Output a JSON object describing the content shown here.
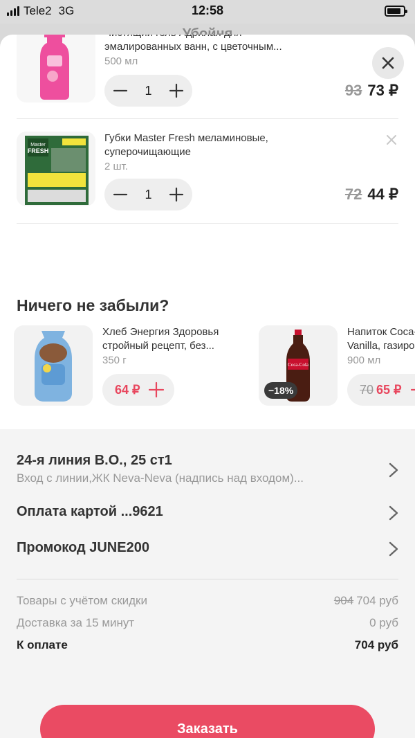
{
  "status_bar": {
    "carrier": "Tele2",
    "network": "3G",
    "time": "12:58",
    "battery_level": 0.85
  },
  "background_title": "Убойня",
  "cart": {
    "items": [
      {
        "name": "Чистящий гель Адрилан для эмалированных ванн, с цветочным...",
        "name_line1": "Чистящий гель Адрилан для",
        "name_line2": "эмалированных ванн, с цветочным...",
        "weight": "500 мл",
        "quantity": "1",
        "old_price": "93",
        "price": "73 ₽"
      },
      {
        "name_line1": "Губки Master Fresh меламиновые,",
        "name_line2": "суперочищающие",
        "weight": "2 шт.",
        "quantity": "1",
        "old_price": "72",
        "price": "44 ₽"
      }
    ]
  },
  "recommendations": {
    "title": "Ничего не забыли?",
    "items": [
      {
        "name_line1": "Хлеб Энергия Здоровья",
        "name_line2": "стройный рецепт, без...",
        "weight": "350 г",
        "price": "64 ₽"
      },
      {
        "name_line1": "Напиток Coca-Cola",
        "name_line2": "Vanilla, газированный",
        "weight": "900 мл",
        "old_price": "70",
        "price": "65 ₽",
        "discount": "−18%"
      }
    ]
  },
  "checkout": {
    "address_main": "24-я линия В.О., 25 ст1",
    "address_sub": "Вход с линии,ЖК Neva-Neva (надпись над входом)...",
    "payment": "Оплата картой ...9621",
    "promo": "Промокод JUNE200",
    "summary": {
      "goods_label": "Товары с учётом скидки",
      "goods_old": "904",
      "goods_value": "704 руб",
      "delivery_label": "Доставка за 15 минут",
      "delivery_value": "0 руб",
      "total_label": "К оплате",
      "total_value": "704 руб"
    },
    "order_button": "Заказать"
  },
  "colors": {
    "accent": "#ea4b63",
    "price_red": "#e8475e"
  }
}
